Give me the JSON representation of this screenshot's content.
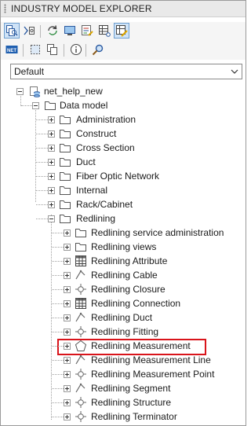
{
  "panel": {
    "title": "INDUSTRY MODEL EXPLORER"
  },
  "toolbar1": [
    {
      "name": "explorer-view-icon",
      "active": true
    },
    {
      "name": "split-view-icon",
      "active": false
    },
    {
      "name": "refresh-icon",
      "active": false
    },
    {
      "name": "monitor-icon",
      "active": false
    },
    {
      "name": "edit-form-icon",
      "active": false
    },
    {
      "name": "table-grid-icon",
      "active": false
    },
    {
      "name": "edit-table-icon",
      "active": true
    }
  ],
  "toolbar2": [
    {
      "name": "net-icon"
    },
    {
      "name": "select-dashed-icon"
    },
    {
      "name": "copy-icon"
    },
    {
      "name": "info-icon"
    },
    {
      "name": "search-icon"
    }
  ],
  "dropdown": {
    "value": "Default"
  },
  "tree": {
    "root": "net_help_new",
    "data_model": "Data model",
    "categories": [
      "Administration",
      "Construct",
      "Cross Section",
      "Duct",
      "Fiber Optic Network",
      "Internal",
      "Rack/Cabinet",
      "Redlining"
    ],
    "redlining_items": [
      {
        "label": "Redlining service administration",
        "icon": "folder-icon"
      },
      {
        "label": "Redlining views",
        "icon": "folder-icon"
      },
      {
        "label": "Redlining Attribute",
        "icon": "table-icon"
      },
      {
        "label": "Redlining Cable",
        "icon": "line-feature-icon"
      },
      {
        "label": "Redlining Closure",
        "icon": "point-feature-icon"
      },
      {
        "label": "Redlining Connection",
        "icon": "table-icon"
      },
      {
        "label": "Redlining Duct",
        "icon": "line-feature-icon"
      },
      {
        "label": "Redlining Fitting",
        "icon": "point-feature-icon"
      },
      {
        "label": "Redlining Measurement",
        "icon": "polygon-feature-icon",
        "highlighted": true
      },
      {
        "label": "Redlining Measurement Line",
        "icon": "line-feature-icon"
      },
      {
        "label": "Redlining Measurement Point",
        "icon": "point-feature-icon"
      },
      {
        "label": "Redlining Segment",
        "icon": "line-feature-icon"
      },
      {
        "label": "Redlining Structure",
        "icon": "point-feature-icon"
      },
      {
        "label": "Redlining Terminator",
        "icon": "point-feature-icon"
      }
    ]
  }
}
